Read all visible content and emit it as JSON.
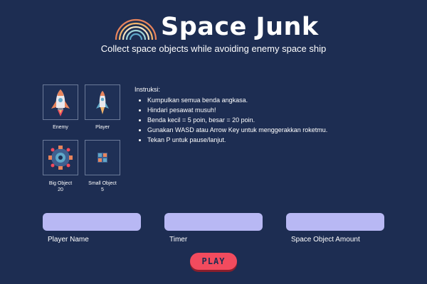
{
  "header": {
    "title": "Space Junk",
    "subtitle": "Collect space objects while avoiding enemy space ship"
  },
  "tiles": [
    {
      "label": "Enemy",
      "sublabel": "",
      "icon": "enemy-rocket-icon"
    },
    {
      "label": "Player",
      "sublabel": "",
      "icon": "player-rocket-icon"
    },
    {
      "label": "Big Object",
      "sublabel": "20",
      "icon": "big-object-icon"
    },
    {
      "label": "Small Object",
      "sublabel": "5",
      "icon": "small-object-icon"
    }
  ],
  "instructions": {
    "title": "Instruksi:",
    "items": [
      "Kumpulkan semua benda angkasa.",
      "Hindari pesawat musuh!",
      "Benda kecil = 5 poin, besar = 20 poin.",
      "Gunakan WASD atau Arrow Key untuk menggerakkan roketmu.",
      "Tekan P untuk pause/lanjut."
    ]
  },
  "form": {
    "player_name": {
      "label": "Player Name",
      "value": "",
      "placeholder": ""
    },
    "timer": {
      "label": "Timer",
      "value": "",
      "placeholder": ""
    },
    "space_object_amount": {
      "label": "Space Object Amount",
      "value": "",
      "placeholder": ""
    }
  },
  "play_button": {
    "label": "PLAY"
  },
  "colors": {
    "background": "#1d2d52",
    "input": "#b8b8f4",
    "play": "#f24b5e",
    "logo_arcs": [
      "#e8845c",
      "#f2b36b",
      "#f4e4c1",
      "#9fd3d6",
      "#5fa8c9"
    ]
  }
}
